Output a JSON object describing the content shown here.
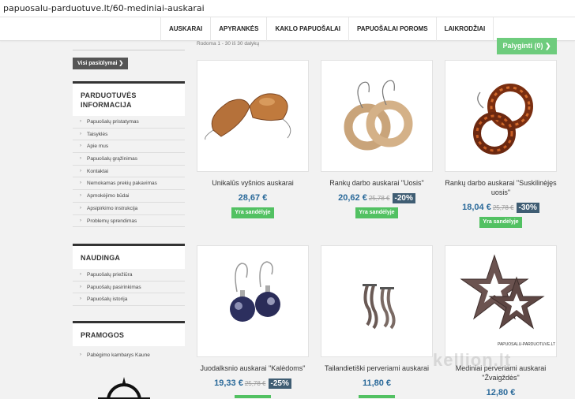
{
  "browser": {
    "url": "papuosalu-parduotuve.lt/60-mediniai-auskarai"
  },
  "nav": {
    "items": [
      "AUSKARAI",
      "APYRANKĖS",
      "KAKLO PAPUOŠALAI",
      "PAPUOŠALAI POROMS",
      "LAIKRODŽIAI"
    ]
  },
  "sidebar": {
    "all_offers": "Visi pasiūlymai",
    "info": {
      "title": "PARDUOTUVĖS INFORMACIJA",
      "links": [
        "Papuošalų pristatymas",
        "Taisyklės",
        "Apie mus",
        "Papuošalų grąžinimas",
        "Kontaktai",
        "Nemokamas prekių pakavimas",
        "Apmokėjimo būdai",
        "Apsipirkimo instrukcija",
        "Problemų sprendimas"
      ]
    },
    "useful": {
      "title": "NAUDINGA",
      "links": [
        "Papuošalų priežiūra",
        "Papuošalų pasirinkimas",
        "Papuošalų istorija"
      ]
    },
    "fun": {
      "title": "PRAMOGOS",
      "links": [
        "Pabėgimo kambarys Kaune"
      ]
    }
  },
  "listing": {
    "count_text": "Rodoma 1 - 30 iš 30 dalykų",
    "compare_label": "Palyginti (0)",
    "compare_arrow": "❯",
    "stock_label": "Yra sandėlyje"
  },
  "products": [
    {
      "name": "Unikalūs vyšnios auskarai",
      "price": "28,67 €",
      "old": "",
      "discount": "",
      "in_stock": true
    },
    {
      "name": "Rankų darbo auskarai \"Uosis\"",
      "price": "20,62 €",
      "old": "25,78 €",
      "discount": "-20%",
      "in_stock": true
    },
    {
      "name": "Rankų darbo auskarai \"Suskilinėjęs uosis\"",
      "price": "18,04 €",
      "old": "25,78 €",
      "discount": "-30%",
      "in_stock": true
    },
    {
      "name": "Juodalksnio auskarai \"Kalėdoms\"",
      "price": "19,33 €",
      "old": "25,78 €",
      "discount": "-25%",
      "in_stock": true
    },
    {
      "name": "Tailandietiški perveriami auskarai",
      "price": "11,80 €",
      "old": "",
      "discount": "",
      "in_stock": true
    },
    {
      "name": "Mediniai perveriami auskarai \"Žvaigždės\"",
      "price": "12,80 €",
      "old": "",
      "discount": "",
      "in_stock": true
    }
  ],
  "image_text": {
    "star_caption": "PAPUOSALU-PARDUOTUVE.LT"
  },
  "watermark": "kellion.lt",
  "icons": {
    "arrow": "chevron-right-icon"
  },
  "colors": {
    "green": "#52c162",
    "price_blue": "#2b6a9a",
    "discount": "#3f5d73"
  }
}
